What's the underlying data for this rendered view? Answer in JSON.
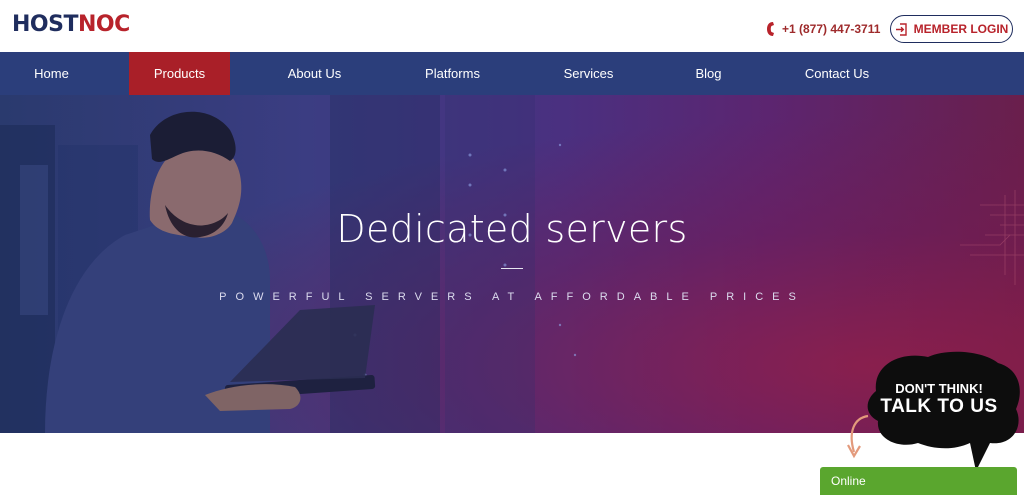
{
  "header": {
    "logo_host": "HOST",
    "logo_noc": "NOC",
    "phone": "+1 (877) 447-3711",
    "login_label": "MEMBER LOGIN"
  },
  "nav": {
    "items": [
      {
        "label": "Home"
      },
      {
        "label": "Products"
      },
      {
        "label": "About Us"
      },
      {
        "label": "Platforms"
      },
      {
        "label": "Services"
      },
      {
        "label": "Blog"
      },
      {
        "label": "Contact Us"
      }
    ],
    "active": "Products"
  },
  "hero": {
    "title": "Dedicated servers",
    "subtitle": "POWERFUL SERVERS AT AFFORDABLE PRICES"
  },
  "chat": {
    "line1": "DON'T THINK!",
    "line2": "TALK TO US",
    "status": "Online"
  },
  "colors": {
    "brand_navy": "#1f2d5e",
    "brand_red": "#b8232b",
    "nav_bg": "#2b3e7b",
    "nav_active": "#a91f28",
    "online_green": "#5aa62e"
  }
}
